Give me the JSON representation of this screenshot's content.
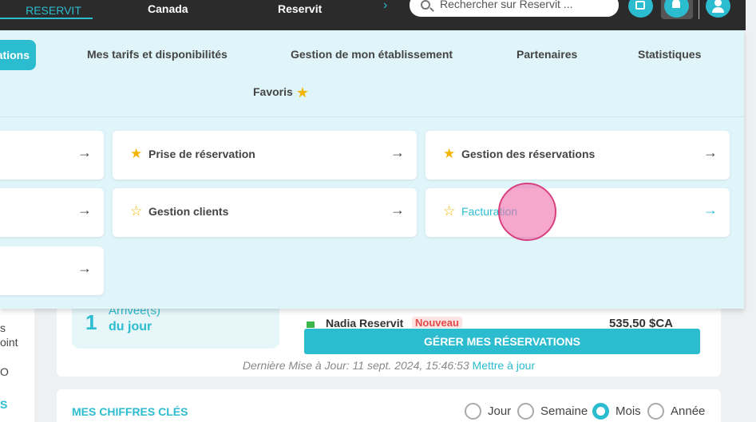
{
  "topbar": {
    "brand": "RESERVIT",
    "nav": [
      "Canada",
      "Reservit"
    ],
    "search_placeholder": "Rechercher sur Reservit ..."
  },
  "menu": {
    "active_tab": "ations",
    "tabs": [
      "Mes tarifs et disponibilités",
      "Gestion de mon établissement",
      "Partenaires",
      "Statistiques"
    ],
    "favoris": "Favoris",
    "cards": [
      {
        "label": "Prise de réservation",
        "favorite": true
      },
      {
        "label": "Gestion des réservations",
        "favorite": true
      },
      {
        "label": "Gestion clients",
        "favorite": false
      },
      {
        "label": "Facturation",
        "favorite": false,
        "hover": true
      }
    ]
  },
  "left_strip": [
    "s",
    "oint",
    "O",
    "S"
  ],
  "arrivals": {
    "count": "1",
    "line1": "Arrivée(s)",
    "line2": "du jour"
  },
  "reservation": {
    "name": "Nadia Reservit",
    "badge": "Nouveau",
    "price": "535,50 $CA"
  },
  "manage_button": "GÉRER MES RÉSERVATIONS",
  "update": {
    "text": "Dernière Mise à Jour: 11 sept. 2024, 15:46:53",
    "link": "Mettre à jour"
  },
  "kpi": {
    "title": "MES CHIFFRES CLÉS",
    "periods": [
      "Jour",
      "Semaine",
      "Mois",
      "Année"
    ],
    "selected": "Mois"
  },
  "colors": {
    "accent": "#2cbccf",
    "topbar": "#2b2b2b",
    "menu_bg": "#dff5f9",
    "star": "#f3b400"
  }
}
